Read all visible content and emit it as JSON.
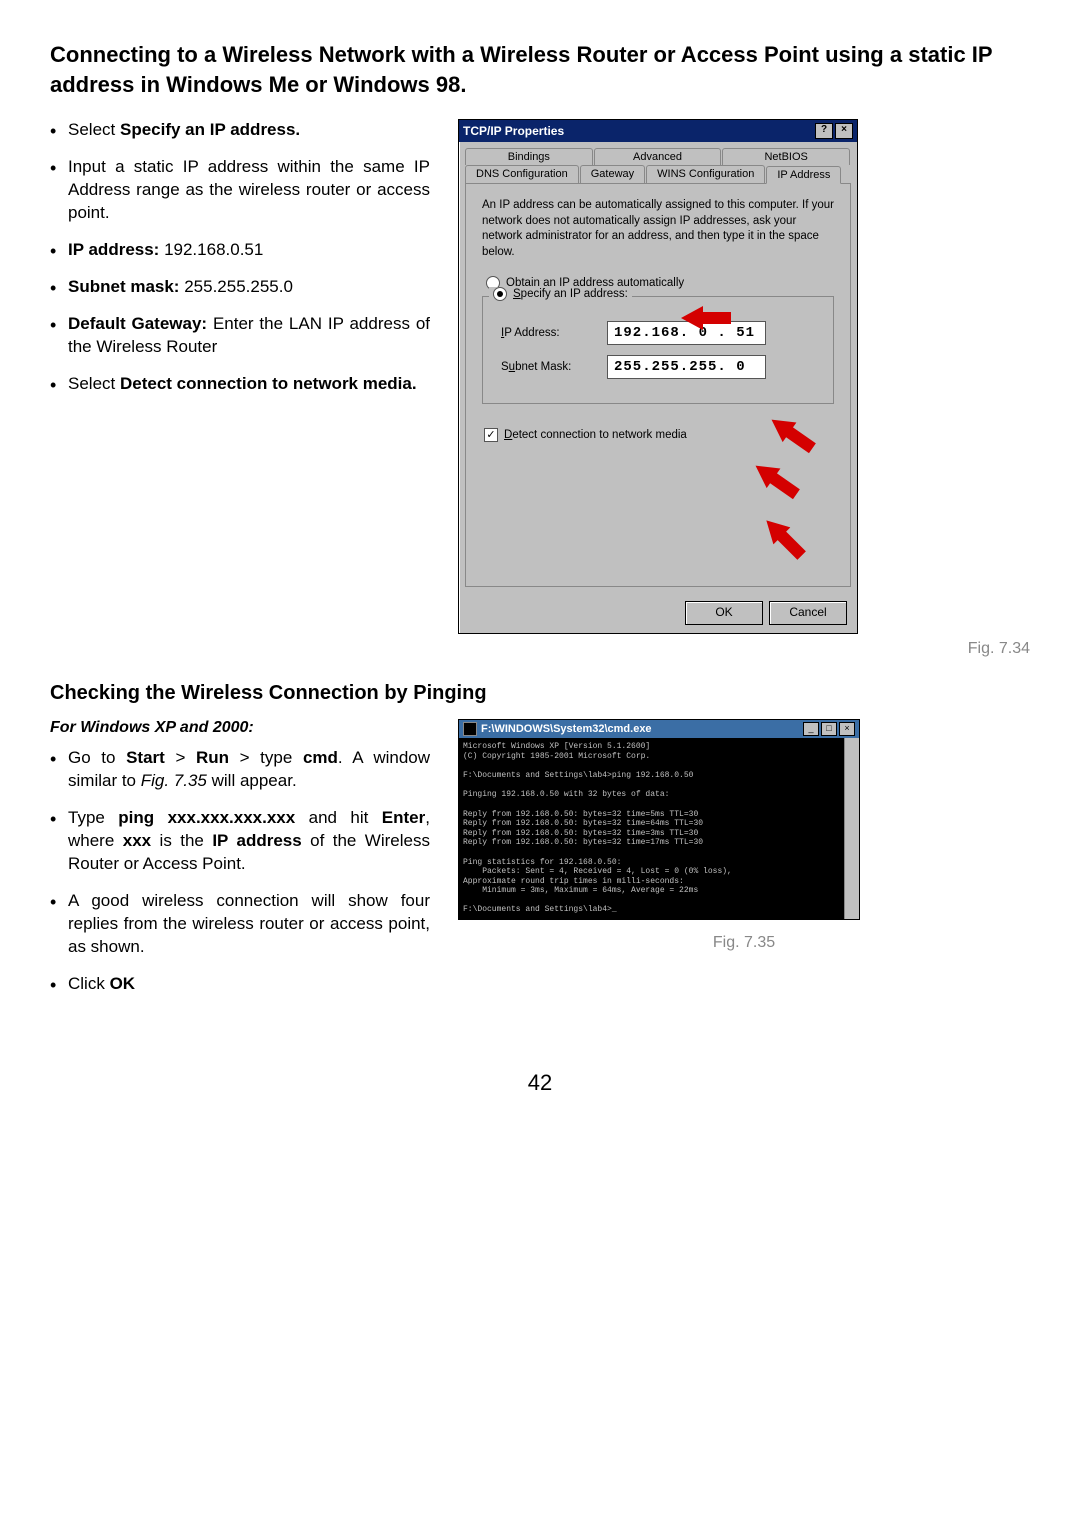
{
  "heading": "Connecting to a Wireless Network with a Wireless Router or Access Point using a static IP address in Windows Me or Windows 98.",
  "bullets_top": {
    "b1_pre": "Select ",
    "b1_bold": "Specify an IP address.",
    "b2": "Input a static IP address within the same IP Address range as the wireless router or access point.",
    "b3_label": "IP address:",
    "b3_val": " 192.168.0.51",
    "b4_label": "Subnet mask:",
    "b4_val": " 255.255.255.0",
    "b5_label": "Default Gateway:",
    "b5_rest": " Enter the LAN IP address of the Wireless Router",
    "b6_pre": "Select ",
    "b6_bold": "Detect connection to network media."
  },
  "dialog": {
    "title": "TCP/IP Properties",
    "help_btn": "?",
    "close_btn": "×",
    "tabs_row1": [
      "Bindings",
      "Advanced",
      "NetBIOS"
    ],
    "tabs_row2": [
      "DNS Configuration",
      "Gateway",
      "WINS Configuration",
      "IP Address"
    ],
    "active_tab": "IP Address",
    "desc": "An IP address can be automatically assigned to this computer. If your network does not automatically assign IP addresses, ask your network administrator for an address, and then type it in the space below.",
    "radio_obtain": "Obtain an IP address automatically",
    "radio_specify": "Specify an IP address:",
    "ip_label": "IP Address:",
    "ip_value": "192.168. 0 . 51",
    "mask_label": "Subnet Mask:",
    "mask_value": "255.255.255. 0",
    "detect_label": "Detect connection to network media",
    "ok": "OK",
    "cancel": "Cancel"
  },
  "fig1": "Fig. 7.34",
  "section2": "Checking the Wireless Connection by Pinging",
  "sub2": "For Windows XP and 2000:",
  "bullets_bottom": {
    "b1_a": "Go to ",
    "b1_start": "Start",
    "b1_gt1": " > ",
    "b1_run": "Run",
    "b1_gt2": " > type ",
    "b1_cmd": "cmd",
    "b1_rest1": ".  A window similar to ",
    "b1_fig": "Fig. 7.35",
    "b1_rest2": " will appear.",
    "b2_a": "Type ",
    "b2_ping": "ping xxx.xxx.xxx.xxx",
    "b2_b": " and hit ",
    "b2_enter": "Enter",
    "b2_c": ", where ",
    "b2_xxx": "xxx",
    "b2_d": " is the ",
    "b2_ip": "IP address",
    "b2_e": " of the Wireless Router or Access Point.",
    "b3": "A good wireless connection will show four replies from the wireless router or access point, as shown.",
    "b4_a": "Click ",
    "b4_ok": "OK"
  },
  "cmd": {
    "title": "F:\\WINDOWS\\System32\\cmd.exe",
    "lines": "Microsoft Windows XP [Version 5.1.2600]\n(C) Copyright 1985-2001 Microsoft Corp.\n\nF:\\Documents and Settings\\lab4>ping 192.168.0.50\n\nPinging 192.168.0.50 with 32 bytes of data:\n\nReply from 192.168.0.50: bytes=32 time=5ms TTL=30\nReply from 192.168.0.50: bytes=32 time=64ms TTL=30\nReply from 192.168.0.50: bytes=32 time=3ms TTL=30\nReply from 192.168.0.50: bytes=32 time=17ms TTL=30\n\nPing statistics for 192.168.0.50:\n    Packets: Sent = 4, Received = 4, Lost = 0 (0% loss),\nApproximate round trip times in milli-seconds:\n    Minimum = 3ms, Maximum = 64ms, Average = 22ms\n\nF:\\Documents and Settings\\lab4>_"
  },
  "fig2": "Fig. 7.35",
  "page_num": "42"
}
